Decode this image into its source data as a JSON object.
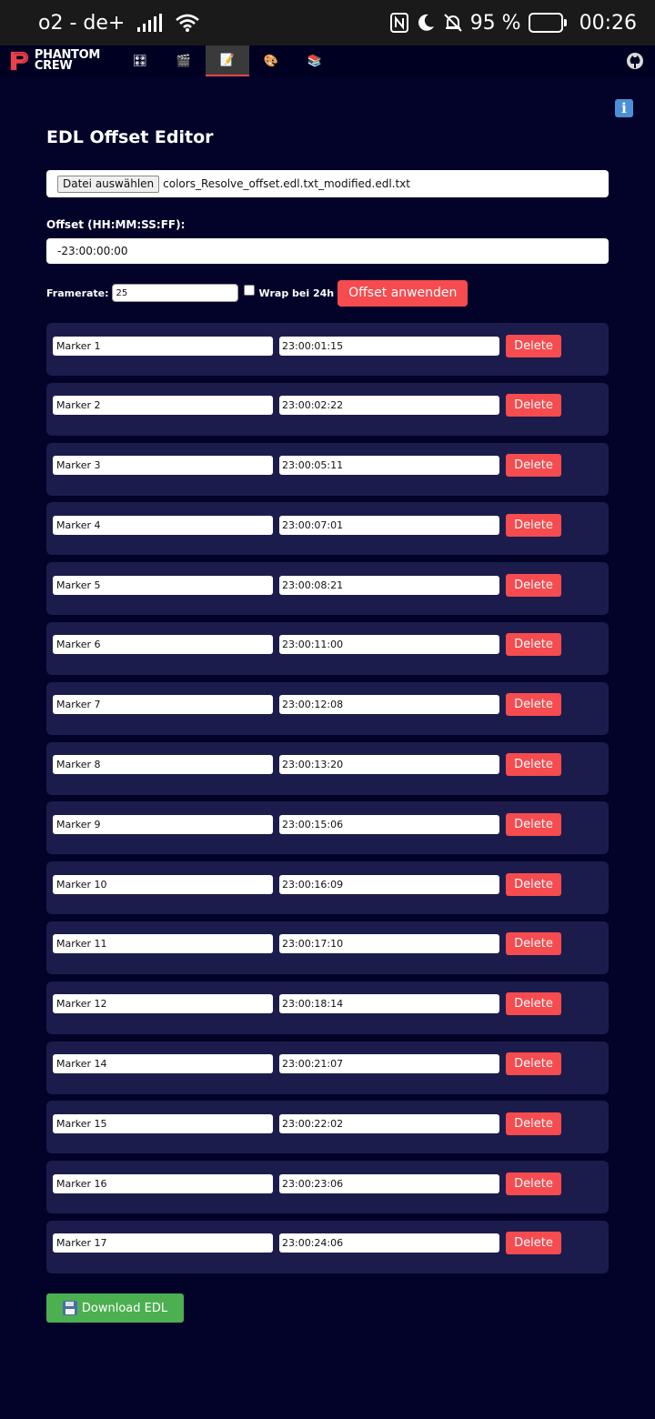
{
  "status_bar": {
    "carrier": "o2 - de+",
    "battery_percent": "95 %",
    "time": "00:26",
    "icons": [
      "signal-icon",
      "wifi-icon",
      "nfc-icon",
      "moon-icon",
      "bell-off-icon",
      "battery-icon"
    ]
  },
  "nav": {
    "logo_line1": "PHANTOM",
    "logo_line2": "CREW",
    "tabs": [
      {
        "icon": "grid-icon",
        "glyph": "🎛"
      },
      {
        "icon": "clapper-icon",
        "glyph": "🎬"
      },
      {
        "icon": "memo-icon",
        "glyph": "📝"
      },
      {
        "icon": "palette-icon",
        "glyph": "🎨"
      },
      {
        "icon": "books-icon",
        "glyph": "📚"
      }
    ],
    "active_tab_index": 2,
    "github_icon": "github-icon"
  },
  "info_glyph": "i",
  "title": "EDL Offset Editor",
  "file": {
    "button_label": "Datei auswählen",
    "file_name": "colors_Resolve_offset.edl.txt_modified.edl.txt"
  },
  "offset": {
    "label": "Offset (HH:MM:SS:FF):",
    "value": "-23:00:00:00"
  },
  "framerate": {
    "label": "Framerate:",
    "value": "25",
    "wrap_label": "Wrap bei 24h",
    "wrap_checked": false,
    "apply_label": "Offset anwenden"
  },
  "markers": [
    {
      "name": "Marker 1",
      "time": "23:00:01:15"
    },
    {
      "name": "Marker 2",
      "time": "23:00:02:22"
    },
    {
      "name": "Marker 3",
      "time": "23:00:05:11"
    },
    {
      "name": "Marker 4",
      "time": "23:00:07:01"
    },
    {
      "name": "Marker 5",
      "time": "23:00:08:21"
    },
    {
      "name": "Marker 6",
      "time": "23:00:11:00"
    },
    {
      "name": "Marker 7",
      "time": "23:00:12:08"
    },
    {
      "name": "Marker 8",
      "time": "23:00:13:20"
    },
    {
      "name": "Marker 9",
      "time": "23:00:15:06"
    },
    {
      "name": "Marker 10",
      "time": "23:00:16:09"
    },
    {
      "name": "Marker 11",
      "time": "23:00:17:10"
    },
    {
      "name": "Marker 12",
      "time": "23:00:18:14"
    },
    {
      "name": "Marker 14",
      "time": "23:00:21:07"
    },
    {
      "name": "Marker 15",
      "time": "23:00:22:02"
    },
    {
      "name": "Marker 16",
      "time": "23:00:23:06"
    },
    {
      "name": "Marker 17",
      "time": "23:00:24:06"
    }
  ],
  "delete_label": "Delete",
  "download_label": "Download EDL",
  "colors": {
    "background": "#03032a",
    "row_background": "#1c1c4c",
    "accent_red": "#f64b4f",
    "download_green": "#4caf50"
  }
}
